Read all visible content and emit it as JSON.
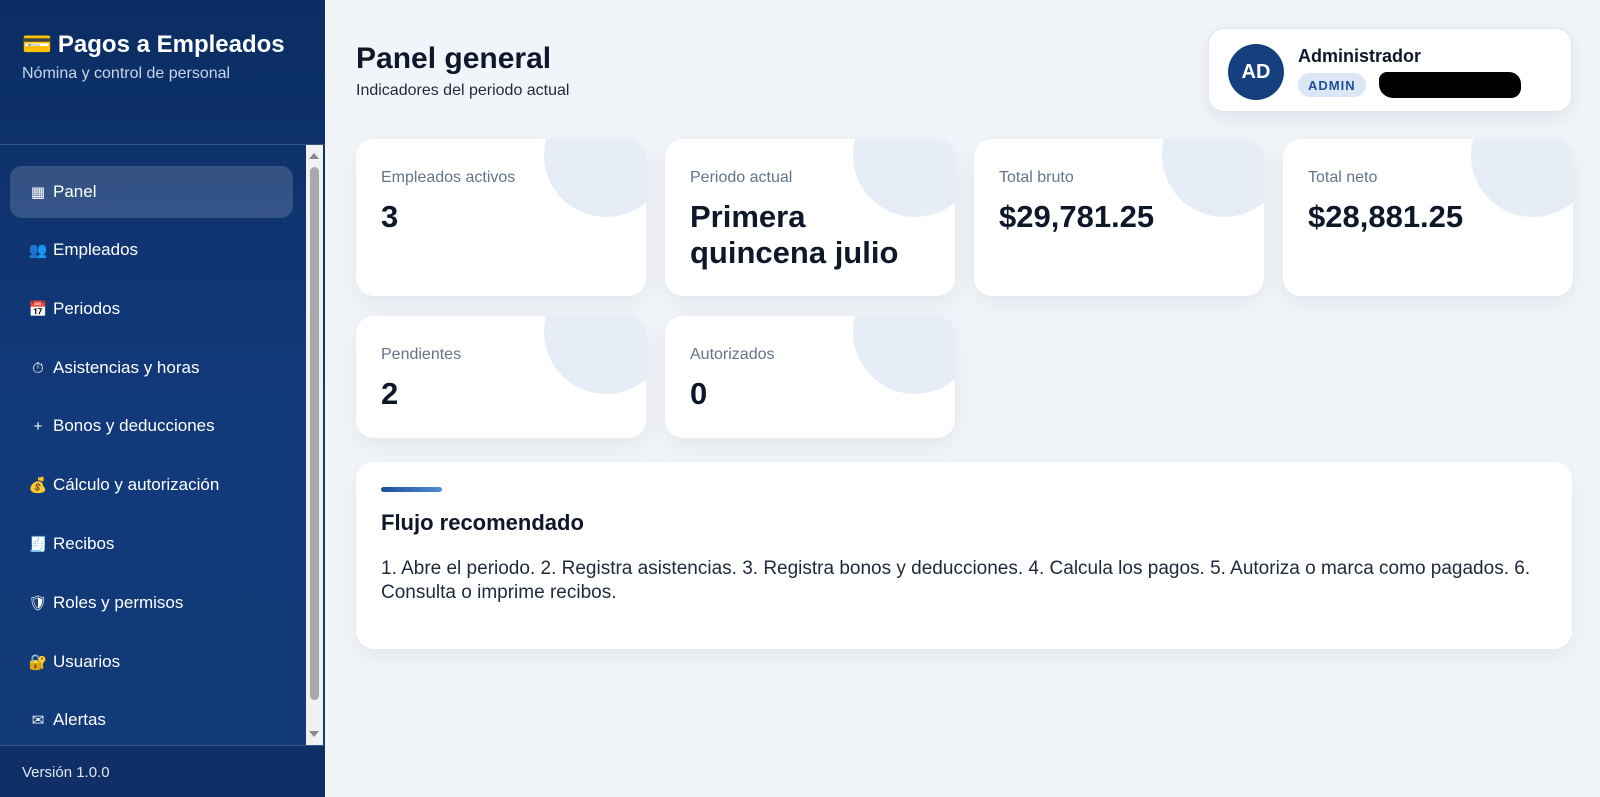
{
  "sidebar": {
    "brand_icon": "💳",
    "brand_title": "Pagos a Empleados",
    "brand_subtitle": "Nómina y control de personal",
    "items": [
      {
        "icon": "▦",
        "icon_name": "grid-icon",
        "label": "Panel",
        "active": true
      },
      {
        "icon": "👥",
        "icon_name": "users-icon",
        "label": "Empleados"
      },
      {
        "icon": "📅",
        "icon_name": "calendar-icon",
        "label": "Periodos"
      },
      {
        "icon": "⏱",
        "icon_name": "stopwatch-icon",
        "label": "Asistencias y horas"
      },
      {
        "icon": "+",
        "icon_name": "plus-icon",
        "label": "Bonos y deducciones"
      },
      {
        "icon": "💰",
        "icon_name": "money-bag-icon",
        "label": "Cálculo y autorización"
      },
      {
        "icon": "🧾",
        "icon_name": "receipt-icon",
        "label": "Recibos"
      },
      {
        "icon": "🛡",
        "icon_name": "shield-icon",
        "label": "Roles y permisos"
      },
      {
        "icon": "🔐",
        "icon_name": "lock-icon",
        "label": "Usuarios"
      },
      {
        "icon": "✉",
        "icon_name": "envelope-icon",
        "label": "Alertas"
      }
    ],
    "version": "Versión 1.0.0"
  },
  "header": {
    "title": "Panel general",
    "subtitle": "Indicadores del periodo actual"
  },
  "user": {
    "initials": "AD",
    "name": "Administrador",
    "role": "ADMIN"
  },
  "stats": [
    {
      "label": "Empleados activos",
      "value": "3"
    },
    {
      "label": "Periodo actual",
      "value": "Primera quincena julio"
    },
    {
      "label": "Total bruto",
      "value": "$29,781.25"
    },
    {
      "label": "Total neto",
      "value": "$28,881.25"
    },
    {
      "label": "Pendientes",
      "value": "2"
    },
    {
      "label": "Autorizados",
      "value": "0"
    }
  ],
  "flow": {
    "title": "Flujo recomendado",
    "text": "1. Abre el periodo. 2. Registra asistencias. 3. Registra bonos y deducciones. 4. Calcula los pagos. 5. Autoriza o marca como pagados. 6. Consulta o imprime recibos."
  },
  "colors": {
    "sidebar_bg": "#0b2d63",
    "accent": "#1d4e99",
    "page_bg": "#f1f5f9"
  }
}
